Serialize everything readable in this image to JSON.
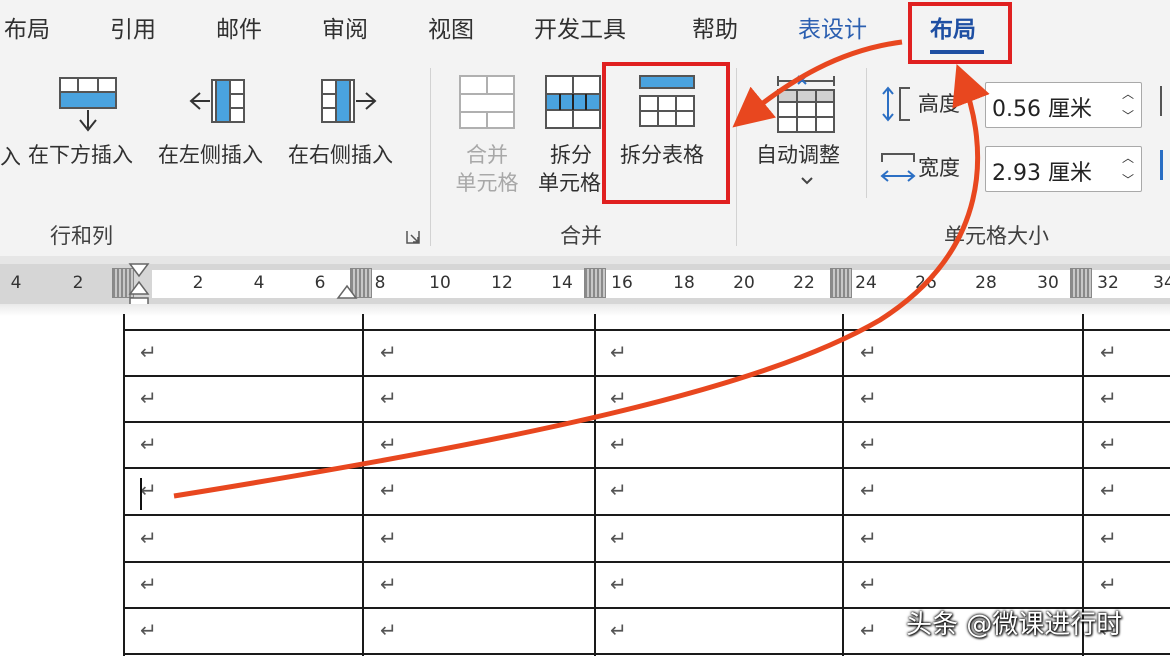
{
  "tabs": [
    {
      "label": "布局"
    },
    {
      "label": "引用"
    },
    {
      "label": "邮件"
    },
    {
      "label": "审阅"
    },
    {
      "label": "视图"
    },
    {
      "label": "开发工具"
    },
    {
      "label": "帮助"
    },
    {
      "label": "表设计"
    },
    {
      "label": "布局"
    }
  ],
  "ribbon": {
    "rows_cols": {
      "cut_insert_label": "入",
      "insert_below": "在下方插入",
      "insert_left": "在左侧插入",
      "insert_right": "在右侧插入",
      "group_label": "行和列"
    },
    "merge": {
      "merge_cells_line1": "合并",
      "merge_cells_line2": "单元格",
      "split_cells_line1": "拆分",
      "split_cells_line2": "单元格",
      "split_table": "拆分表格",
      "group_label": "合并"
    },
    "autofit": {
      "label": "自动调整"
    },
    "cell_size": {
      "height_label": "高度",
      "height_value": "0.56 厘米",
      "width_label": "宽度",
      "width_value": "2.93 厘米",
      "group_label": "单元格大小"
    }
  },
  "ruler": {
    "numbers": [
      "4",
      "2",
      "2",
      "4",
      "6",
      "8",
      "10",
      "12",
      "14",
      "16",
      "18",
      "20",
      "22",
      "24",
      "26",
      "28",
      "30",
      "32",
      "34"
    ]
  },
  "document": {
    "cell_mark": "↵"
  },
  "watermark": "头条 @微课进行时",
  "colors": {
    "accent_blue": "#1e4fa3",
    "highlight_red": "#e02020",
    "arrow_red": "#e8471f",
    "ribbon_bg": "#f3f3f3"
  }
}
